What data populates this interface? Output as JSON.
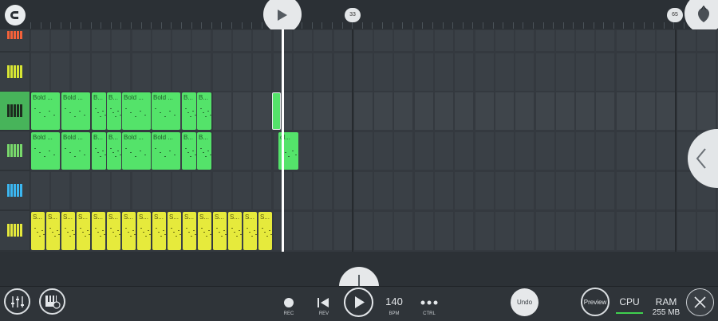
{
  "timeline": {
    "markers": [
      "33",
      "65"
    ]
  },
  "toolbar": {
    "rec_label": "REC",
    "rev_label": "REV",
    "bpm_value": "140",
    "bpm_label": "BPM",
    "ctrl_label": "CTRL",
    "undo_label": "Undo",
    "preview_label": "Preview",
    "cpu_label": "CPU",
    "ram_label": "RAM",
    "ram_value": "255 MB"
  },
  "tracks": [
    {
      "name": "track-1",
      "key_color": "#f2613a"
    },
    {
      "name": "track-2",
      "key_color": "#d7e534"
    },
    {
      "name": "track-3",
      "key_color": "#1d2b1f",
      "active": true
    },
    {
      "name": "track-4",
      "key_color": "#78d86b"
    },
    {
      "name": "track-5",
      "key_color": "#3bb6f0"
    },
    {
      "name": "track-6",
      "key_color": "#e4e83c"
    }
  ],
  "patterns": {
    "row3": [
      "Bold ...",
      "Bold ...",
      "B...",
      "B...",
      "Bold ...",
      "Bold ...",
      "B...",
      "B..."
    ],
    "row4": [
      "Bold ...",
      "Bold ...",
      "B...",
      "B...",
      "Bold ...",
      "Bold ...",
      "B...",
      "B...",
      "ol..."
    ],
    "row6": [
      "S...",
      "S...",
      "S...",
      "S...",
      "S...",
      "S...",
      "S...",
      "S...",
      "S...",
      "S...",
      "S...",
      "S...",
      "S...",
      "S...",
      "S...",
      "S..."
    ]
  },
  "colors": {
    "accent_green": "#54e36a",
    "accent_yellow": "#e6ea3c",
    "playhead": "#ffffff"
  }
}
